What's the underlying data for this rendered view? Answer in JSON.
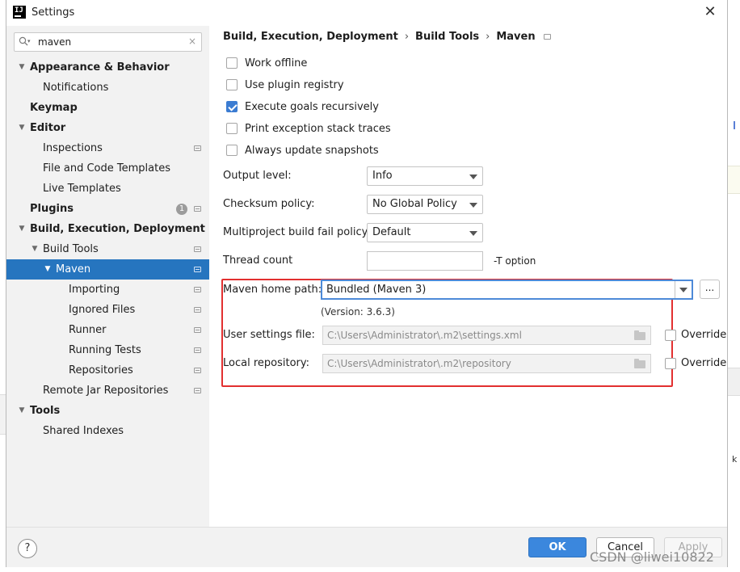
{
  "window": {
    "title": "Settings",
    "close_glyph": "✕"
  },
  "search": {
    "value": "maven",
    "clear_glyph": "×"
  },
  "tree": [
    {
      "label": "Appearance & Behavior",
      "level": 0,
      "bold": true,
      "expanded": true
    },
    {
      "label": "Notifications",
      "level": 1
    },
    {
      "label": "Keymap",
      "level": 0,
      "bold": true
    },
    {
      "label": "Editor",
      "level": 0,
      "bold": true,
      "expanded": true
    },
    {
      "label": "Inspections",
      "level": 1,
      "page_icon": true
    },
    {
      "label": "File and Code Templates",
      "level": 1
    },
    {
      "label": "Live Templates",
      "level": 1
    },
    {
      "label": "Plugins",
      "level": 0,
      "bold": true,
      "badge": "1",
      "page_icon": true
    },
    {
      "label": "Build, Execution, Deployment",
      "level": 0,
      "bold": true,
      "expanded": true
    },
    {
      "label": "Build Tools",
      "level": 1,
      "expanded": true,
      "page_icon": true
    },
    {
      "label": "Maven",
      "level": 2,
      "expanded": true,
      "selected": true,
      "page_icon": true
    },
    {
      "label": "Importing",
      "level": 3,
      "page_icon": true
    },
    {
      "label": "Ignored Files",
      "level": 3,
      "page_icon": true
    },
    {
      "label": "Runner",
      "level": 3,
      "page_icon": true
    },
    {
      "label": "Running Tests",
      "level": 3,
      "page_icon": true
    },
    {
      "label": "Repositories",
      "level": 3,
      "page_icon": true
    },
    {
      "label": "Remote Jar Repositories",
      "level": 1,
      "page_icon": true
    },
    {
      "label": "Tools",
      "level": 0,
      "bold": true,
      "expanded": true
    },
    {
      "label": "Shared Indexes",
      "level": 1
    }
  ],
  "breadcrumb": {
    "items": [
      "Build, Execution, Deployment",
      "Build Tools",
      "Maven"
    ],
    "separator": "›"
  },
  "options": {
    "work_offline": {
      "label": "Work offline",
      "checked": false
    },
    "use_plugin_registry": {
      "label": "Use plugin registry",
      "checked": false
    },
    "execute_goals_recursively": {
      "label": "Execute goals recursively",
      "checked": true
    },
    "print_exception_stack_traces": {
      "label": "Print exception stack traces",
      "checked": false
    },
    "always_update_snapshots": {
      "label": "Always update snapshots",
      "checked": false
    }
  },
  "fields": {
    "output_level": {
      "label": "Output level:",
      "value": "Info"
    },
    "checksum_policy": {
      "label": "Checksum policy:",
      "value": "No Global Policy"
    },
    "multiproject_fail_policy": {
      "label": "Multiproject build fail policy:",
      "value": "Default"
    },
    "thread_count": {
      "label": "Thread count",
      "value": "",
      "hint": "-T option"
    },
    "maven_home": {
      "label": "Maven home path:",
      "value": "Bundled (Maven 3)",
      "version": "(Version: 3.6.3)",
      "browse_label": "..."
    },
    "user_settings": {
      "label": "User settings file:",
      "value": "C:\\Users\\Administrator\\.m2\\settings.xml",
      "override_label": "Override",
      "override_checked": false
    },
    "local_repo": {
      "label": "Local repository:",
      "value": "C:\\Users\\Administrator\\.m2\\repository",
      "override_label": "Override",
      "override_checked": false
    }
  },
  "footer": {
    "help": "?",
    "ok": "OK",
    "cancel": "Cancel",
    "apply": "Apply"
  },
  "watermark": "CSDN @liwei10822",
  "colors": {
    "selection": "#2675bf",
    "primary_button": "#3b87dd",
    "highlight_box": "#e23030",
    "focus_border": "#4d8ad8"
  }
}
